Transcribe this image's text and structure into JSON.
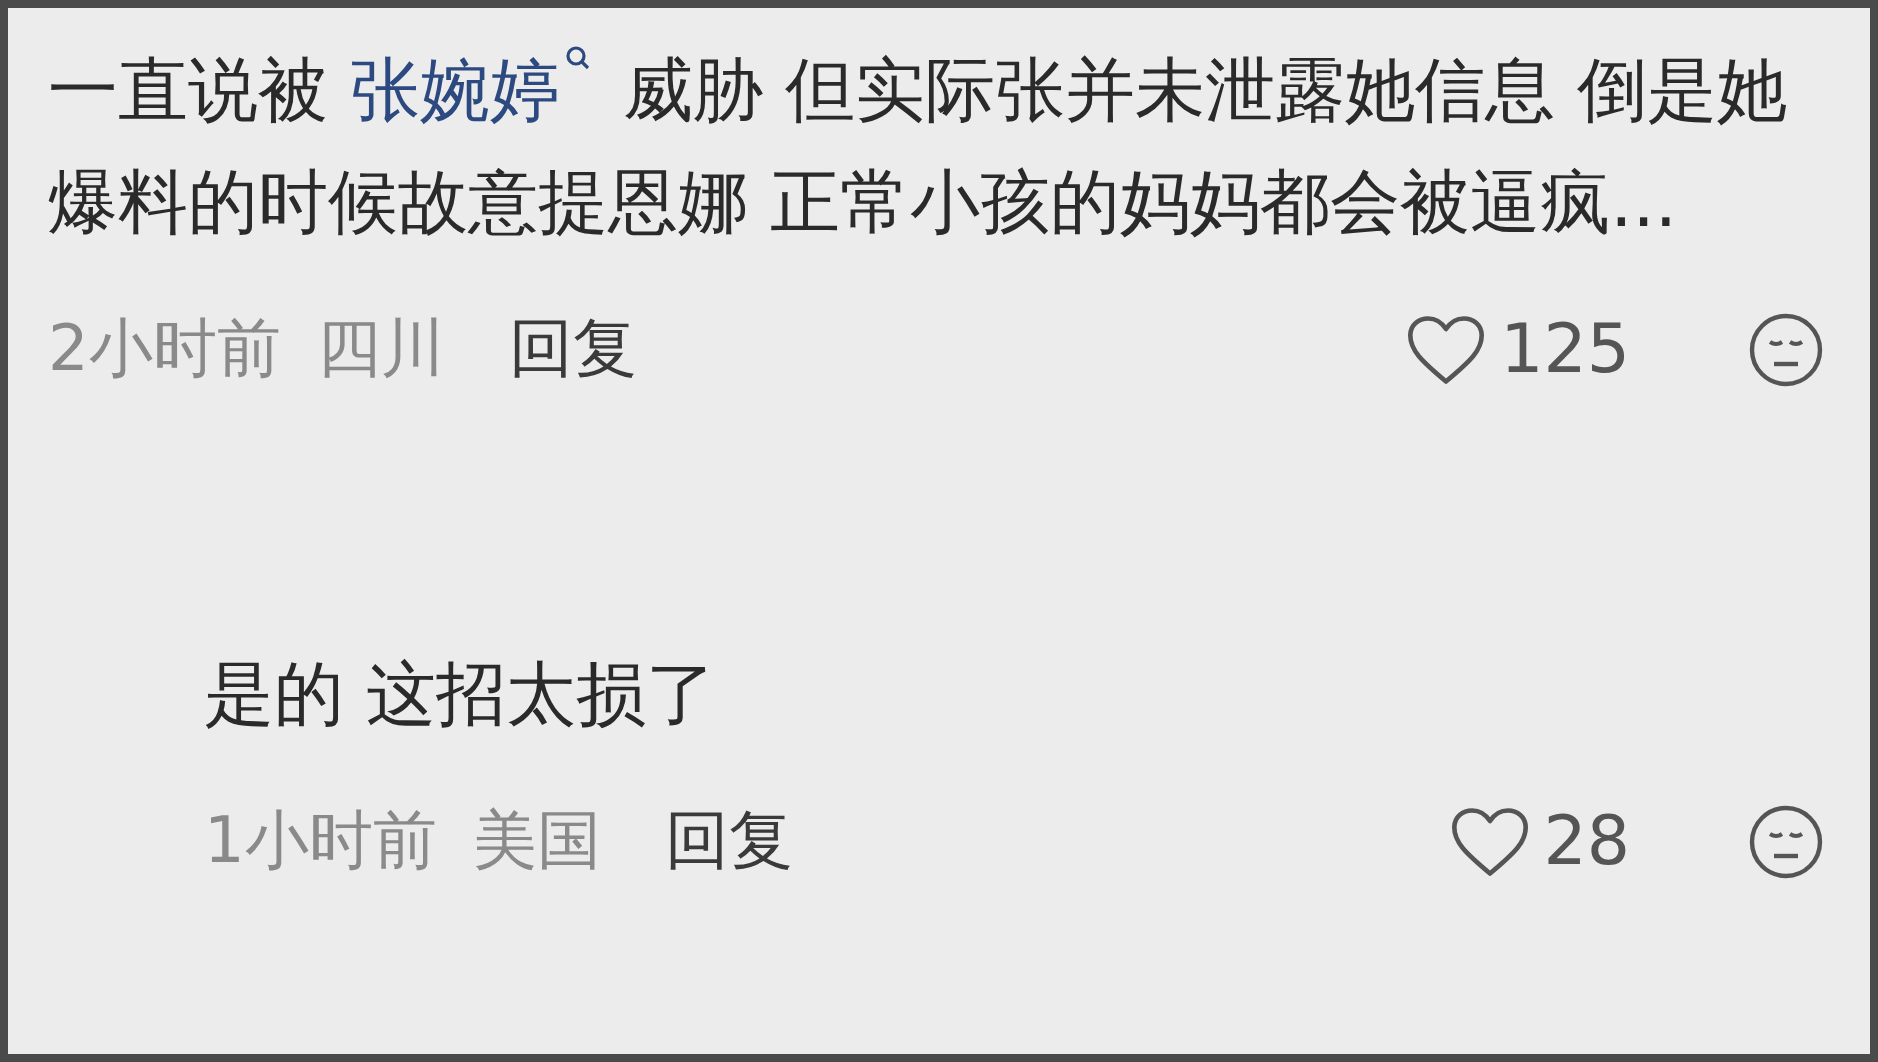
{
  "comments": [
    {
      "kind": "comment",
      "text_before": "一直说被 ",
      "mention": "张婉婷",
      "text_after": " 威胁 但实际张并未泄露她信息 倒是她爆料的时候故意提恩娜 正常小孩的妈妈都会被逼疯...",
      "time": "2小时前",
      "location": "四川",
      "reply_label": "回复",
      "likes": "125"
    },
    {
      "kind": "reply",
      "text_before": "是的 这招太损了",
      "time": "1小时前",
      "location": "美国",
      "reply_label": "回复",
      "likes": "28"
    }
  ]
}
